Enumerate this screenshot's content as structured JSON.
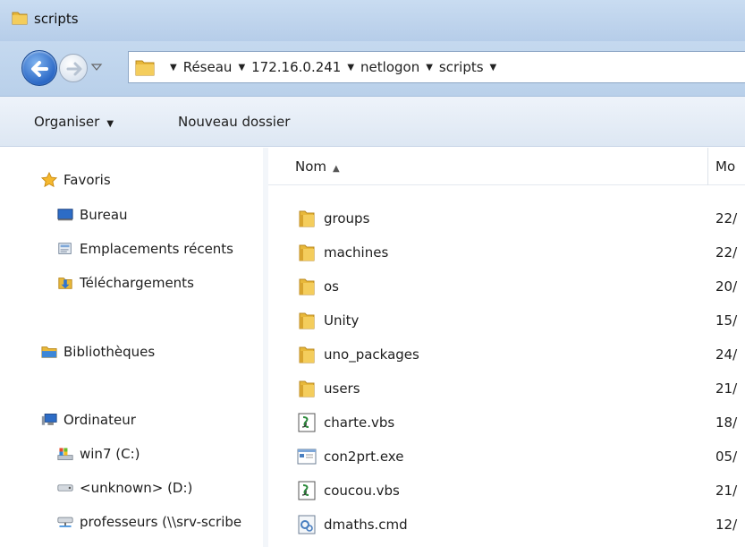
{
  "window": {
    "title": "scripts"
  },
  "address": {
    "crumbs": [
      {
        "label": "Réseau"
      },
      {
        "label": "172.16.0.241"
      },
      {
        "label": "netlogon"
      },
      {
        "label": "scripts"
      }
    ]
  },
  "toolbar": {
    "organise_label": "Organiser",
    "new_folder_label": "Nouveau dossier"
  },
  "nav": {
    "favorites": "Favoris",
    "desktop": "Bureau",
    "recent": "Emplacements récents",
    "downloads": "Téléchargements",
    "libraries": "Bibliothèques",
    "computer": "Ordinateur",
    "drive_c": "win7 (C:)",
    "drive_d": "<unknown> (D:)",
    "net_drive": "professeurs (\\\\srv-scribe"
  },
  "columns": {
    "name": "Nom",
    "modified": "Mo"
  },
  "files": [
    {
      "name": "groups",
      "date": "22/",
      "icon": "folder-icon"
    },
    {
      "name": "machines",
      "date": "22/",
      "icon": "folder-icon"
    },
    {
      "name": "os",
      "date": "20/",
      "icon": "folder-icon"
    },
    {
      "name": "Unity",
      "date": "15/",
      "icon": "folder-icon"
    },
    {
      "name": "uno_packages",
      "date": "24/",
      "icon": "folder-icon"
    },
    {
      "name": "users",
      "date": "21/",
      "icon": "folder-icon"
    },
    {
      "name": "charte.vbs",
      "date": "18/",
      "icon": "vbs-script-icon"
    },
    {
      "name": "con2prt.exe",
      "date": "05/",
      "icon": "exe-icon"
    },
    {
      "name": "coucou.vbs",
      "date": "21/",
      "icon": "vbs-script-icon"
    },
    {
      "name": "dmaths.cmd",
      "date": "12/",
      "icon": "cmd-script-icon"
    }
  ],
  "colors": {
    "titlebar": "#c9dcf1",
    "folder": "#e8b83a",
    "accent": "#2a67c5"
  }
}
